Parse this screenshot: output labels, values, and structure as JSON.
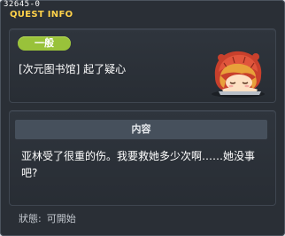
{
  "window": {
    "id_label": "32645-0",
    "title": "QUEST INFO"
  },
  "quest": {
    "badge_label": "一般",
    "name": "[次元图书馆] 起了疑心",
    "portrait_icon": "sleeping-girl-red-hood-icon"
  },
  "content": {
    "header": "内容",
    "description": "亚林受了很重的伤。我要救她多少次啊……她没事吧?"
  },
  "status": {
    "label": "狀態:",
    "value": "可開始"
  },
  "colors": {
    "title": "#ffd24a",
    "badge": "#99c23a",
    "background": "#2a2f36"
  }
}
